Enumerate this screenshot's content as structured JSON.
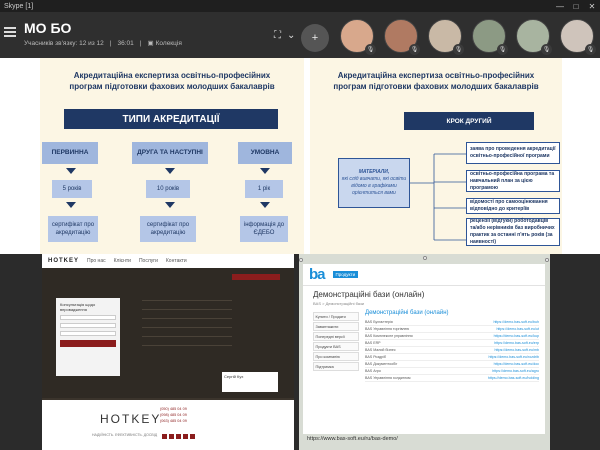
{
  "window": {
    "title": "Skype [1]",
    "controls": [
      "—",
      "□",
      "✕"
    ]
  },
  "header": {
    "chat_title": "МО БО",
    "participants_line": "Учасників зв'язку: 12 из 12",
    "duration": "36:01",
    "collection_label": "Колекція",
    "participants": [
      {
        "color": "#d8a88c"
      },
      {
        "color": "#b07a62"
      },
      {
        "color": "#c9b9a6"
      },
      {
        "color": "#8c9a84"
      },
      {
        "color": "#a8b4a0"
      },
      {
        "color": "#cfc4bb"
      }
    ],
    "mic_glyph": "🎙"
  },
  "slide1": {
    "title_line1": "Акредитаційна експертиза освітньо-професійних",
    "title_line2": "програм підготовки фахових молодших бакалаврів",
    "types_header": "ТИПИ АКРЕДИТАЦІЇ",
    "columns": [
      {
        "head": "ПЕРВИННА",
        "years": "5 років",
        "result": "сертифікат про акредитацію"
      },
      {
        "head": "ДРУГА ТА НАСТУПНІ",
        "years": "10 років",
        "result": "сертифікат про акредитацію"
      },
      {
        "head": "УМОВНА",
        "years": "1 рік",
        "result": "інформація до ЄДЕБО"
      }
    ]
  },
  "slide2": {
    "title_line1": "Акредитаційна експертиза освітньо-професійних",
    "title_line2": "програм підготовки фахових молодших бакалаврів",
    "step_label": "КРОК ДРУГИЙ",
    "left_box_title": "МАТЕРІАЛИ,",
    "left_box_text": "які слід вивчати, які освіти",
    "left_box_text2": "відомо в графіками",
    "left_box_text3": "орієнтиться вами",
    "items": [
      "заява про проведення акредитації освітньо-професійної програми",
      "освітньо-професійна програма та навчальний план за цією програмою",
      "відомості про самооцінювання відповідно до критеріїв",
      "рецензії (відгуки) роботодавців та/або нерівників баз виробничих практик за останні п'ять років (за наявності)"
    ]
  },
  "browserA": {
    "logo": "HOTKEY",
    "nav": [
      "Про нас",
      "Клієнти",
      "Послуги",
      "Контакти"
    ],
    "form_title": "Консультація щодо впровадження",
    "footer_logo": "HOTKEY",
    "footer_tag": "НАДІЙНІСТЬ. ЕФЕКТИВНІСТЬ. ДОСВІД",
    "phones": [
      "(050) 485 04 09",
      "(098) 485 04 09",
      "(063) 485 04 09"
    ],
    "contact_name": "Сергій Кух"
  },
  "browserB": {
    "logo": "ba",
    "tab": "Продукти",
    "page_heading": "Демонстраційні бази (онлайн)",
    "breadcrumb": "BAS > Демонстраційні бази",
    "section_title": "Демонстраційні бази (онлайн)",
    "side_items": [
      "Купити / Продати",
      "Завантажити",
      "Попередні версії",
      "Продукти BAS",
      "Про компанію",
      "Підтримка"
    ],
    "rows": [
      {
        "name": "BAS Бухгалтерія",
        "link": "https://demo.bas-soft.eu/buh"
      },
      {
        "name": "BAS Управління торгівлею",
        "link": "https://demo.bas-soft.eu/ut"
      },
      {
        "name": "BAS Комплексне управління",
        "link": "https://demo.bas-soft.eu/kup"
      },
      {
        "name": "BAS ERP",
        "link": "https://demo.bas-soft.eu/erp"
      },
      {
        "name": "BAS Малий бізнес",
        "link": "https://demo.bas-soft.eu/mb"
      },
      {
        "name": "BAS Роздріб",
        "link": "https://demo.bas-soft.eu/rozdrib"
      },
      {
        "name": "BAS Документообіг",
        "link": "https://demo.bas-soft.eu/doc"
      },
      {
        "name": "BAS Агро",
        "link": "https://demo.bas-soft.eu/agro"
      },
      {
        "name": "BAS Управління холдингом",
        "link": "https://demo.bas-soft.eu/holding"
      }
    ],
    "url": "https://www.bas-soft.eu/ru/bas-demo/"
  },
  "colors": {
    "navy": "#1f3864",
    "slide_bg": "#fcf6e4",
    "box": "#b4c6e7",
    "accent_red": "#8b1d1d",
    "bas_blue": "#1a8ed8"
  }
}
